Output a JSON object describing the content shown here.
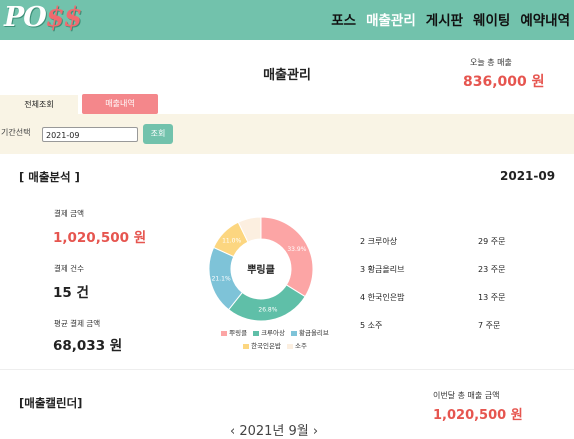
{
  "header": {
    "logo_main": "PO",
    "logo_accent": "$$",
    "nav": [
      "포스",
      "매출관리",
      "게시판",
      "웨이팅",
      "예약내역"
    ]
  },
  "page": {
    "title": "매출관리",
    "today_label": "오늘 총 매출",
    "today_value": "836,000 원"
  },
  "tabs": {
    "all": "전체조회",
    "sales": "매출내역"
  },
  "filter": {
    "label": "기간선택",
    "value": "2021-09",
    "button": "조회"
  },
  "analysis": {
    "title": "[ 매출분석 ]",
    "month": "2021-09",
    "stats": [
      {
        "label": "결제 금액",
        "value": "1,020,500 원"
      },
      {
        "label": "결제 건수",
        "value": "15 건"
      },
      {
        "label": "평균 결제 금액",
        "value": "68,033 원"
      }
    ],
    "center_label": "뿌링클",
    "ranking": [
      {
        "name": "2 크루아상",
        "count": "29 주문"
      },
      {
        "name": "3 황금올리브",
        "count": "23 주문"
      },
      {
        "name": "4 한국인은밥",
        "count": "13 주문"
      },
      {
        "name": "5 소주",
        "count": "7 주문"
      }
    ]
  },
  "chart_data": {
    "type": "pie",
    "categories": [
      "뿌링클",
      "크루아상",
      "황금올리브",
      "한국인은밥",
      "소주"
    ],
    "values": [
      33.9,
      26.8,
      21.1,
      11.0,
      7.2
    ],
    "value_labels": [
      "33.9%",
      "26.8%",
      "21.1%",
      "11.0%",
      ""
    ],
    "colors": [
      "#fca5a5",
      "#5fbfa8",
      "#7ec3d8",
      "#fcd680",
      "#fcefe0"
    ],
    "legend_position": "bottom"
  },
  "calendar": {
    "title": "[매출캘린더]",
    "total_label": "이번달 총 매출 금액",
    "total_value": "1,020,500 원",
    "month_label": "‹  2021년 9월  ›"
  }
}
